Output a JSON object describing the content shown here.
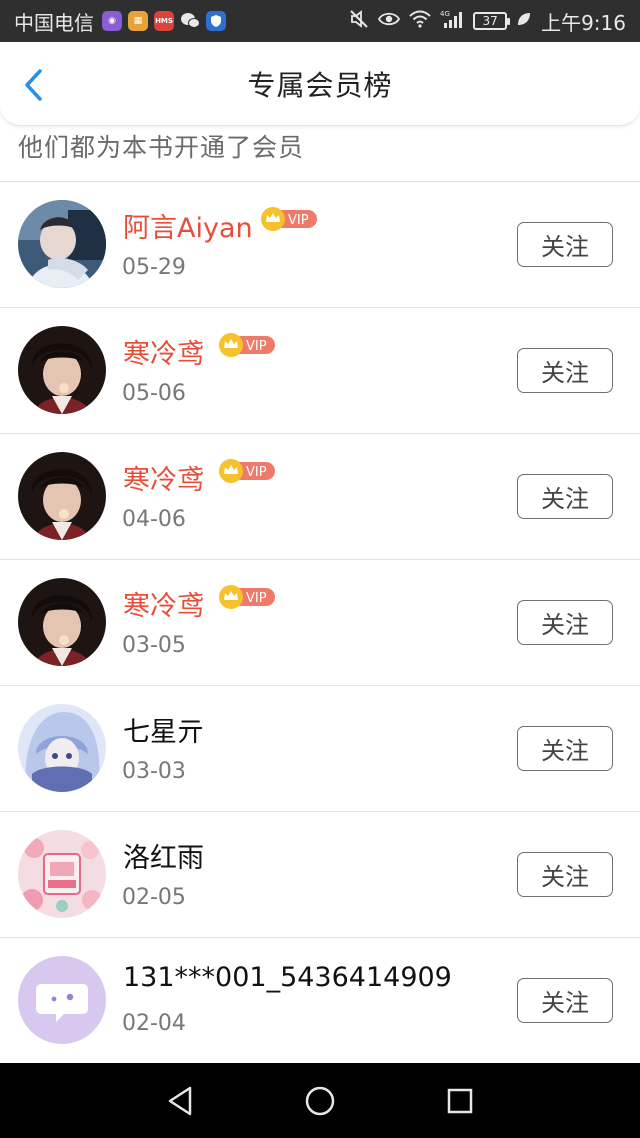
{
  "status_bar": {
    "carrier": "中国电信",
    "battery": "37",
    "time": "上午9:16"
  },
  "header": {
    "title": "专属会员榜"
  },
  "subtitle": "他们都为本书开通了会员",
  "vip_label": "VIP",
  "rows": [
    {
      "name": "阿言Aiyan",
      "date": "05-29",
      "vip": true,
      "follow_label": "关注"
    },
    {
      "name": "寒冷鸢",
      "date": "05-06",
      "vip": true,
      "follow_label": "关注"
    },
    {
      "name": "寒冷鸢",
      "date": "04-06",
      "vip": true,
      "follow_label": "关注"
    },
    {
      "name": "寒冷鸢",
      "date": "03-05",
      "vip": true,
      "follow_label": "关注"
    },
    {
      "name": "七星亓",
      "date": "03-03",
      "vip": false,
      "follow_label": "关注"
    },
    {
      "name": "洛红雨",
      "date": "02-05",
      "vip": false,
      "follow_label": "关注"
    },
    {
      "name": "131***001_5436414909",
      "date": "02-04",
      "vip": false,
      "follow_label": "关注"
    }
  ],
  "colors": {
    "vip_name": "#e84d3a",
    "vip_badge": "#f07a6a",
    "crown": "#f5c22b",
    "back_arrow": "#2a8fe8"
  }
}
